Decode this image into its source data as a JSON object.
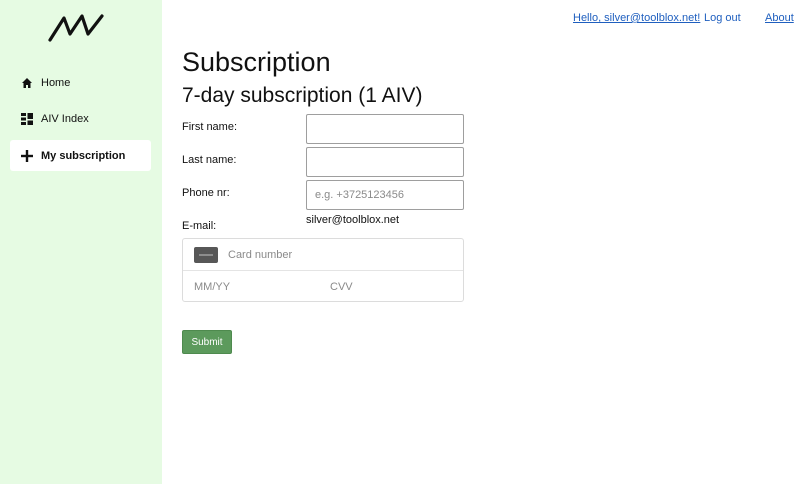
{
  "sidebar": {
    "logo_text": "AIV",
    "items": [
      {
        "label": "Home",
        "icon": "home-icon"
      },
      {
        "label": "AIV Index",
        "icon": "dashboard-icon"
      },
      {
        "label": "My subscription",
        "icon": "plus-icon",
        "active": true
      }
    ]
  },
  "topnav": {
    "hello": "Hello, silver@toolblox.net!",
    "logout": "Log out",
    "about": "About"
  },
  "main": {
    "title": "Subscription",
    "subtitle": "7-day subscription (1 AIV)",
    "form": {
      "first_name_label": "First name:",
      "first_name_value": "",
      "last_name_label": "Last name:",
      "last_name_value": "",
      "phone_label": "Phone nr:",
      "phone_placeholder": "e.g. +3725123456",
      "email_label": "E-mail:",
      "email_value": "silver@toolblox.net",
      "card_number_placeholder": "Card number",
      "expiry_placeholder": "MM/YY",
      "cvv_placeholder": "CVV",
      "submit_label": "Submit"
    }
  },
  "colors": {
    "sidebar_bg": "#e6fbe3",
    "submit_bg": "#5c9a5c",
    "link": "#1f5fbf"
  }
}
